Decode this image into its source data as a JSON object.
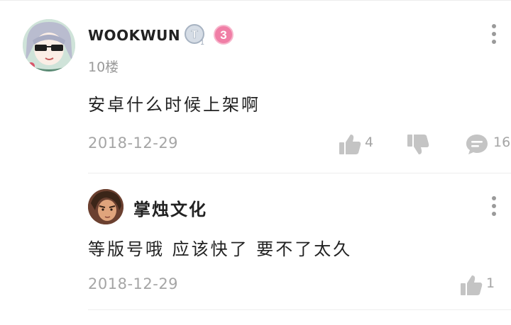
{
  "comment": {
    "username": "WOOKWUN",
    "floor": "10楼",
    "text": "安卓什么时候上架啊",
    "date": "2018-12-29",
    "like_count": "4",
    "reply_count": "16"
  },
  "reply": {
    "username": "掌烛文化",
    "text": "等版号哦 应该快了 要不了太久",
    "date": "2018-12-29",
    "like_count": "1"
  },
  "colors": {
    "badge_pink": "#f07ea6",
    "badge_silver": "#b8c4d2",
    "icon_gray": "#c4c4c4",
    "muted_text": "#a5a5a5"
  },
  "icons": [
    "more-vertical-icon",
    "thumbs-up-icon",
    "thumbs-down-icon",
    "comment-bubble-icon"
  ]
}
